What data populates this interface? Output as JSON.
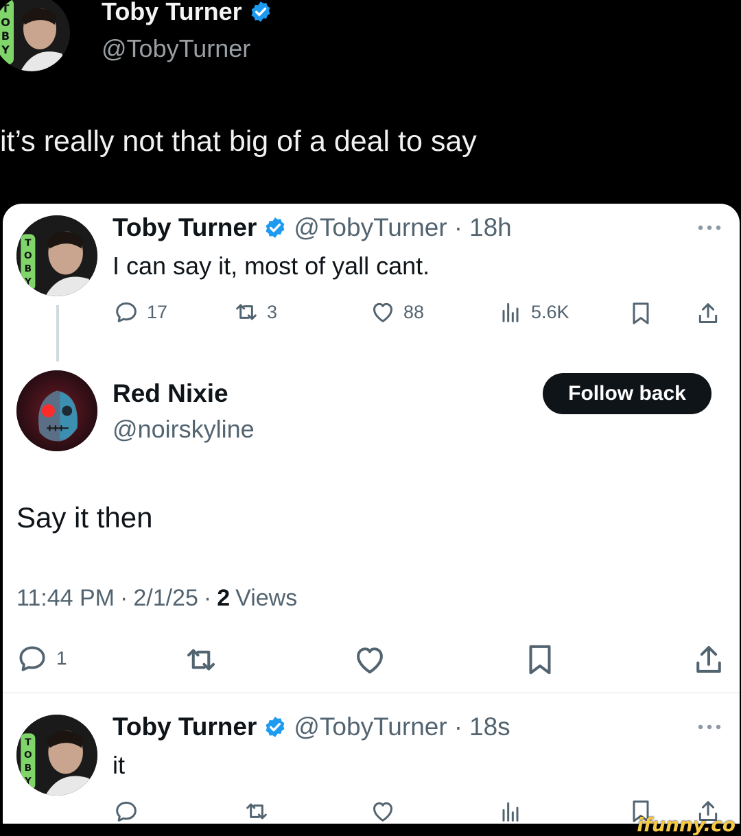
{
  "outer_tweet": {
    "name": "Toby Turner",
    "handle": "@TobyTurner",
    "text": "it’s really not that big of a deal to say",
    "avatar_icon": "toby-avatar"
  },
  "quoted_thread": {
    "tweet1": {
      "name": "Toby Turner",
      "handle": "@TobyTurner",
      "sep": "·",
      "time": "18h",
      "text": "I can say it, most of yall cant.",
      "replies": "17",
      "retweets": "3",
      "likes": "88",
      "views": "5.6K"
    },
    "reply": {
      "name": "Red Nixie",
      "handle": "@noirskyline",
      "follow_label": "Follow back",
      "text": "Say it then",
      "time": "11:44 PM",
      "date": "2/1/25",
      "sep": "·",
      "views_count": "2",
      "views_label": "Views",
      "replies": "1"
    },
    "tweet2": {
      "name": "Toby Turner",
      "handle": "@TobyTurner",
      "sep": "·",
      "time": "18s",
      "text": "it"
    }
  },
  "watermark": "ifunny.co",
  "colors": {
    "verified": "#1d9bf0",
    "button_bg": "#0f1419",
    "secondary_text": "#536471",
    "watermark": "#f6c945"
  }
}
